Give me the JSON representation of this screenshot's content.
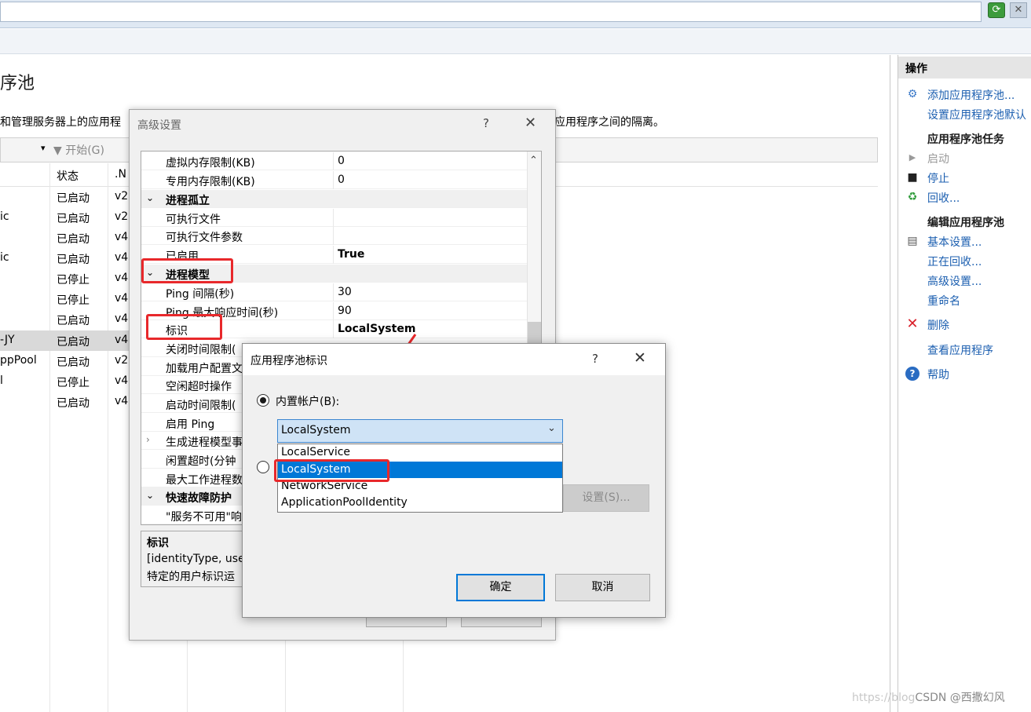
{
  "main": {
    "title": "序池",
    "desc_left": "和管理服务器上的应用程",
    "desc_right": "应用程序之间的隔离。",
    "filter_start": "▼ 开始(G)",
    "columns": {
      "status": "状态",
      "net": ".N"
    },
    "rows": [
      {
        "name": "",
        "status": "已启动",
        "net": "v2"
      },
      {
        "name": "ic",
        "status": "已启动",
        "net": "v2"
      },
      {
        "name": "",
        "status": "已启动",
        "net": "v4"
      },
      {
        "name": "ic",
        "status": "已启动",
        "net": "v4"
      },
      {
        "name": "",
        "status": "已停止",
        "net": "v4"
      },
      {
        "name": "",
        "status": "已停止",
        "net": "v4"
      },
      {
        "name": "",
        "status": "已启动",
        "net": "v4"
      },
      {
        "name": "-JY",
        "status": "已启动",
        "net": "v4"
      },
      {
        "name": "ppPool",
        "status": "已启动",
        "net": "v2"
      },
      {
        "name": "l",
        "status": "已停止",
        "net": "v4"
      },
      {
        "name": "",
        "status": "已启动",
        "net": "v4"
      }
    ]
  },
  "actions": {
    "title": "操作",
    "add_pool": "添加应用程序池...",
    "set_defaults": "设置应用程序池默认",
    "tasks_header": "应用程序池任务",
    "start": "启动",
    "stop": "停止",
    "recycle": "回收...",
    "edit_header": "编辑应用程序池",
    "basic": "基本设置...",
    "recycling": "正在回收...",
    "advanced": "高级设置...",
    "rename": "重命名",
    "delete": "删除",
    "view_apps": "查看应用程序",
    "help": "帮助"
  },
  "advanced_dialog": {
    "title": "高级设置",
    "help_glyph": "?",
    "close_glyph": "✕",
    "rows": [
      {
        "name": "虚拟内存限制(KB)",
        "value": "0"
      },
      {
        "name": "专用内存限制(KB)",
        "value": "0"
      },
      {
        "name": "进程孤立",
        "value": ""
      },
      {
        "name": "可执行文件",
        "value": ""
      },
      {
        "name": "可执行文件参数",
        "value": ""
      },
      {
        "name": "已启用",
        "value": "True"
      },
      {
        "name": "进程模型",
        "value": ""
      },
      {
        "name": "Ping 间隔(秒)",
        "value": "30"
      },
      {
        "name": "Ping 最大响应时间(秒)",
        "value": "90"
      },
      {
        "name": "标识",
        "value": "LocalSystem"
      },
      {
        "name": "关闭时间限制(",
        "value": ""
      },
      {
        "name": "加载用户配置文",
        "value": ""
      },
      {
        "name": "空闲超时操作",
        "value": ""
      },
      {
        "name": "启动时间限制(",
        "value": ""
      },
      {
        "name": "启用 Ping",
        "value": ""
      },
      {
        "name": "生成进程模型事",
        "value": ""
      },
      {
        "name": "闲置超时(分钟",
        "value": ""
      },
      {
        "name": "最大工作进程数",
        "value": ""
      },
      {
        "name": "快速故障防护",
        "value": ""
      },
      {
        "name": "\"服务不可用\"响",
        "value": ""
      }
    ],
    "desc_title": "标识",
    "desc_line1": "[identityType, use",
    "desc_line2": "特定的用户标识运"
  },
  "identity_dialog": {
    "title": "应用程序池标识",
    "help_glyph": "?",
    "close_glyph": "✕",
    "builtin_label": "内置帐户(B):",
    "combo_value": "LocalSystem",
    "options": [
      "LocalService",
      "LocalSystem",
      "NetworkService",
      "ApplicationPoolIdentity"
    ],
    "settings_button": "设置(S)...",
    "ok": "确定",
    "cancel": "取消"
  },
  "watermark": {
    "url": "https://blog",
    "author": "CSDN @西撒幻风"
  }
}
